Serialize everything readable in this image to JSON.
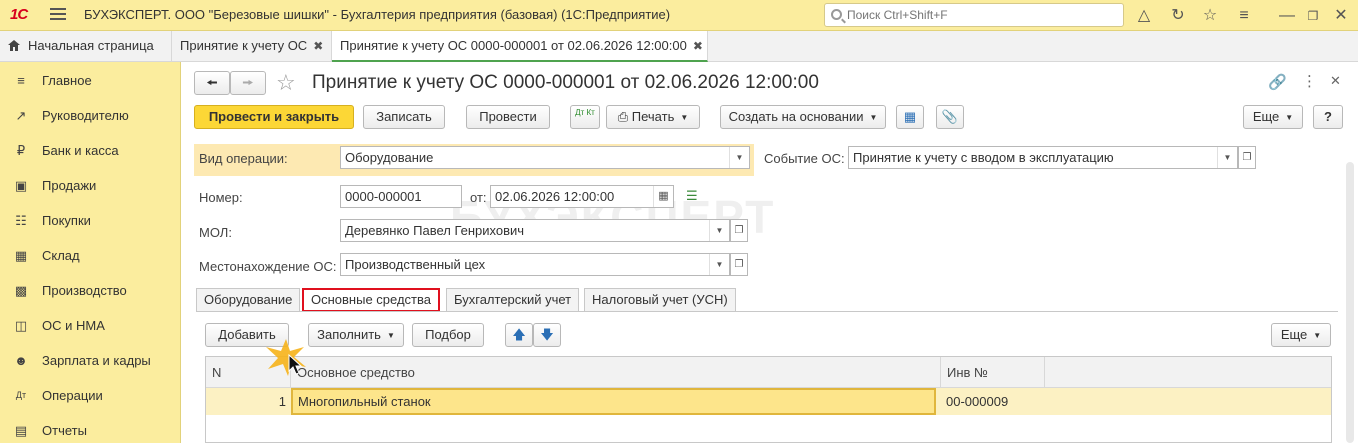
{
  "titlebar": {
    "logo": "1С",
    "title": "БУХЭКСПЕРТ. ООО \"Березовые шишки\" - Бухгалтерия предприятия (базовая)  (1С:Предприятие)",
    "search_placeholder": "Поиск Ctrl+Shift+F"
  },
  "tabs": [
    {
      "label": "Начальная страница"
    },
    {
      "label": "Принятие к учету ОС"
    },
    {
      "label": "Принятие к учету ОС 0000-000001 от 02.06.2026 12:00:00"
    }
  ],
  "sidebar": {
    "items": [
      {
        "label": "Главное"
      },
      {
        "label": "Руководителю"
      },
      {
        "label": "Банк и касса"
      },
      {
        "label": "Продажи"
      },
      {
        "label": "Покупки"
      },
      {
        "label": "Склад"
      },
      {
        "label": "Производство"
      },
      {
        "label": "ОС и НМА"
      },
      {
        "label": "Зарплата и кадры"
      },
      {
        "label": "Операции"
      },
      {
        "label": "Отчеты"
      }
    ]
  },
  "form": {
    "title": "Принятие к учету ОС 0000-000001 от 02.06.2026 12:00:00",
    "toolbar": {
      "post_close": "Провести и закрыть",
      "save": "Записать",
      "post": "Провести",
      "print": "Печать",
      "create_based": "Создать на основании",
      "more": "Еще",
      "help": "?",
      "dtkt": "Дт Кт"
    },
    "fields": {
      "operation_label": "Вид операции:",
      "operation_value": "Оборудование",
      "event_label": "Событие ОС:",
      "event_value": "Принятие к учету с вводом в эксплуатацию",
      "number_label": "Номер:",
      "number_value": "0000-000001",
      "date_label": "от:",
      "date_value": "02.06.2026 12:00:00",
      "mol_label": "МОЛ:",
      "mol_value": "Деревянко Павел Генрихович",
      "location_label": "Местонахождение ОС:",
      "location_value": "Производственный цех"
    },
    "watermark": "БУХЭКСПЕРТ",
    "form_tabs": [
      {
        "label": "Оборудование"
      },
      {
        "label": "Основные средства"
      },
      {
        "label": "Бухгалтерский учет"
      },
      {
        "label": "Налоговый учет (УСН)"
      }
    ],
    "table_toolbar": {
      "add": "Добавить",
      "fill": "Заполнить",
      "select": "Подбор",
      "more": "Еще"
    },
    "table": {
      "columns": [
        "N",
        "Основное средство",
        "Инв №"
      ],
      "rows": [
        {
          "n": "1",
          "asset": "Многопильный станок",
          "inv": "00-000009"
        }
      ]
    }
  }
}
